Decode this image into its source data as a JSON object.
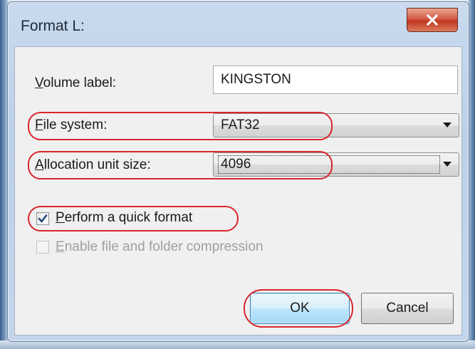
{
  "window": {
    "title": "Format L:",
    "close_label": "x"
  },
  "volume_label": {
    "label": "Volume label:",
    "value": "KINGSTON"
  },
  "file_system": {
    "label": "File system:",
    "selected": "FAT32"
  },
  "allocation": {
    "label": "Allocation unit size:",
    "selected": "4096"
  },
  "quick_format": {
    "label": "Perform a quick format",
    "checked": true
  },
  "compression": {
    "label": "Enable file and folder compression",
    "checked": false,
    "enabled": false
  },
  "buttons": {
    "ok": "OK",
    "cancel": "Cancel"
  },
  "icons": {
    "close": "close-icon",
    "dropdown": "chevron-down-icon",
    "check": "checkmark-icon"
  },
  "colors": {
    "annotation": "#d8262a",
    "accent": "#3c7fb1"
  }
}
